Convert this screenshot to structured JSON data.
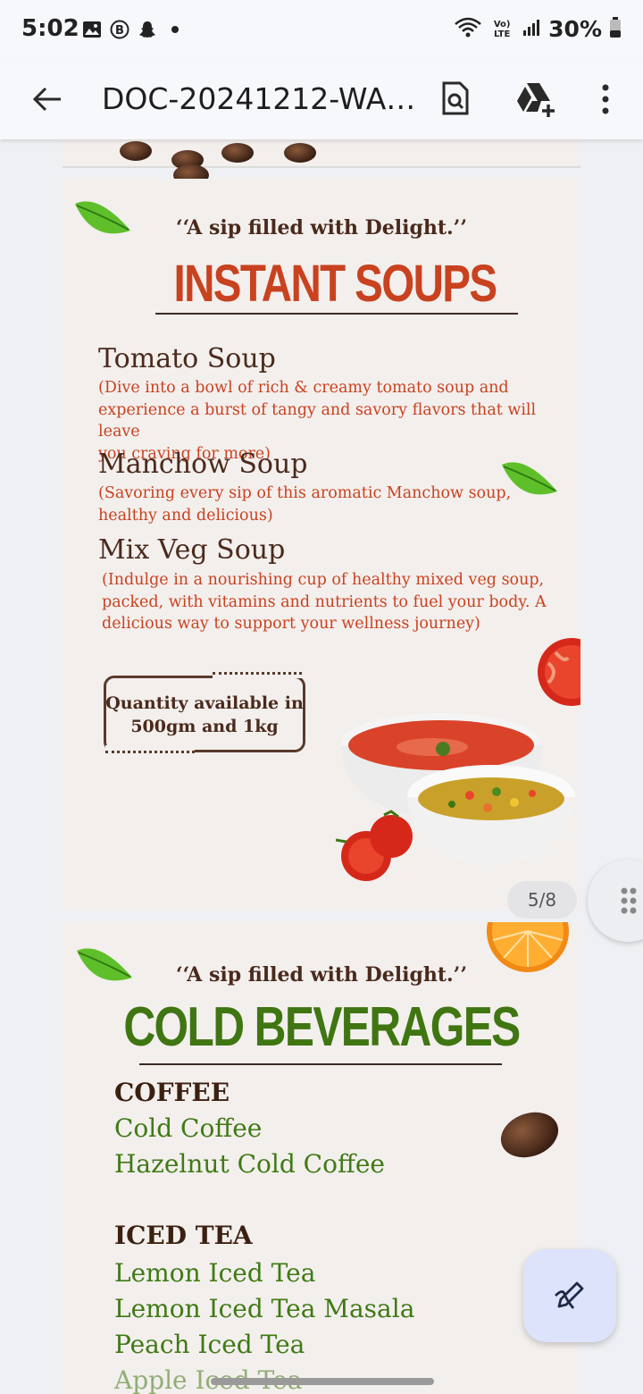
{
  "status_bar": {
    "time": "5:02",
    "network_label": "Vo) LTE",
    "battery": "30%"
  },
  "app_bar": {
    "title": "DOC-20241212-WA…"
  },
  "soups_page": {
    "tagline": "‘‘A sip filled with Delight.’’",
    "heading": "INSTANT SOUPS",
    "items": [
      {
        "title": "Tomato Soup",
        "lines": [
          "(Dive into a bowl of rich & creamy tomato soup and",
          "experience a burst of tangy and savory flavors that will leave",
          "you craving for more)"
        ]
      },
      {
        "title": "Manchow  Soup",
        "lines": [
          "(Savoring every sip of this aromatic Manchow soup,",
          "healthy and delicious)"
        ]
      },
      {
        "title": "Mix Veg Soup",
        "lines": [
          "(Indulge in a nourishing cup of healthy mixed veg soup,",
          "packed, with vitamins and nutrients to fuel your body. A",
          "delicious way to support your wellness journey)"
        ]
      }
    ],
    "quantity_lines": [
      "Quantity available in",
      "500gm and 1kg"
    ],
    "page_indicator": "5/8"
  },
  "beverages_page": {
    "tagline": "‘‘A sip filled with Delight.’’",
    "heading": "COLD BEVERAGES",
    "coffee": {
      "title": "COFFEE",
      "items": [
        "Cold Coffee",
        "Hazelnut Cold Coffee"
      ]
    },
    "iced_tea": {
      "title": "ICED TEA",
      "items": [
        "Lemon Iced Tea",
        "Lemon Iced Tea Masala",
        "Peach Iced Tea",
        "Apple Iced Tea"
      ]
    }
  },
  "colors": {
    "soup_heading": "#c9421f",
    "beverage_heading": "#3f7612",
    "brown_text": "#4a2a1c",
    "page_bg": "#f3efed"
  },
  "icons": [
    "image-icon",
    "bitmoji-icon",
    "snapchat-icon",
    "wifi-icon",
    "signal-icon",
    "battery-icon",
    "back-arrow-icon",
    "search-document-icon",
    "drive-add-icon",
    "more-vert-icon",
    "edit-pen-icon"
  ]
}
